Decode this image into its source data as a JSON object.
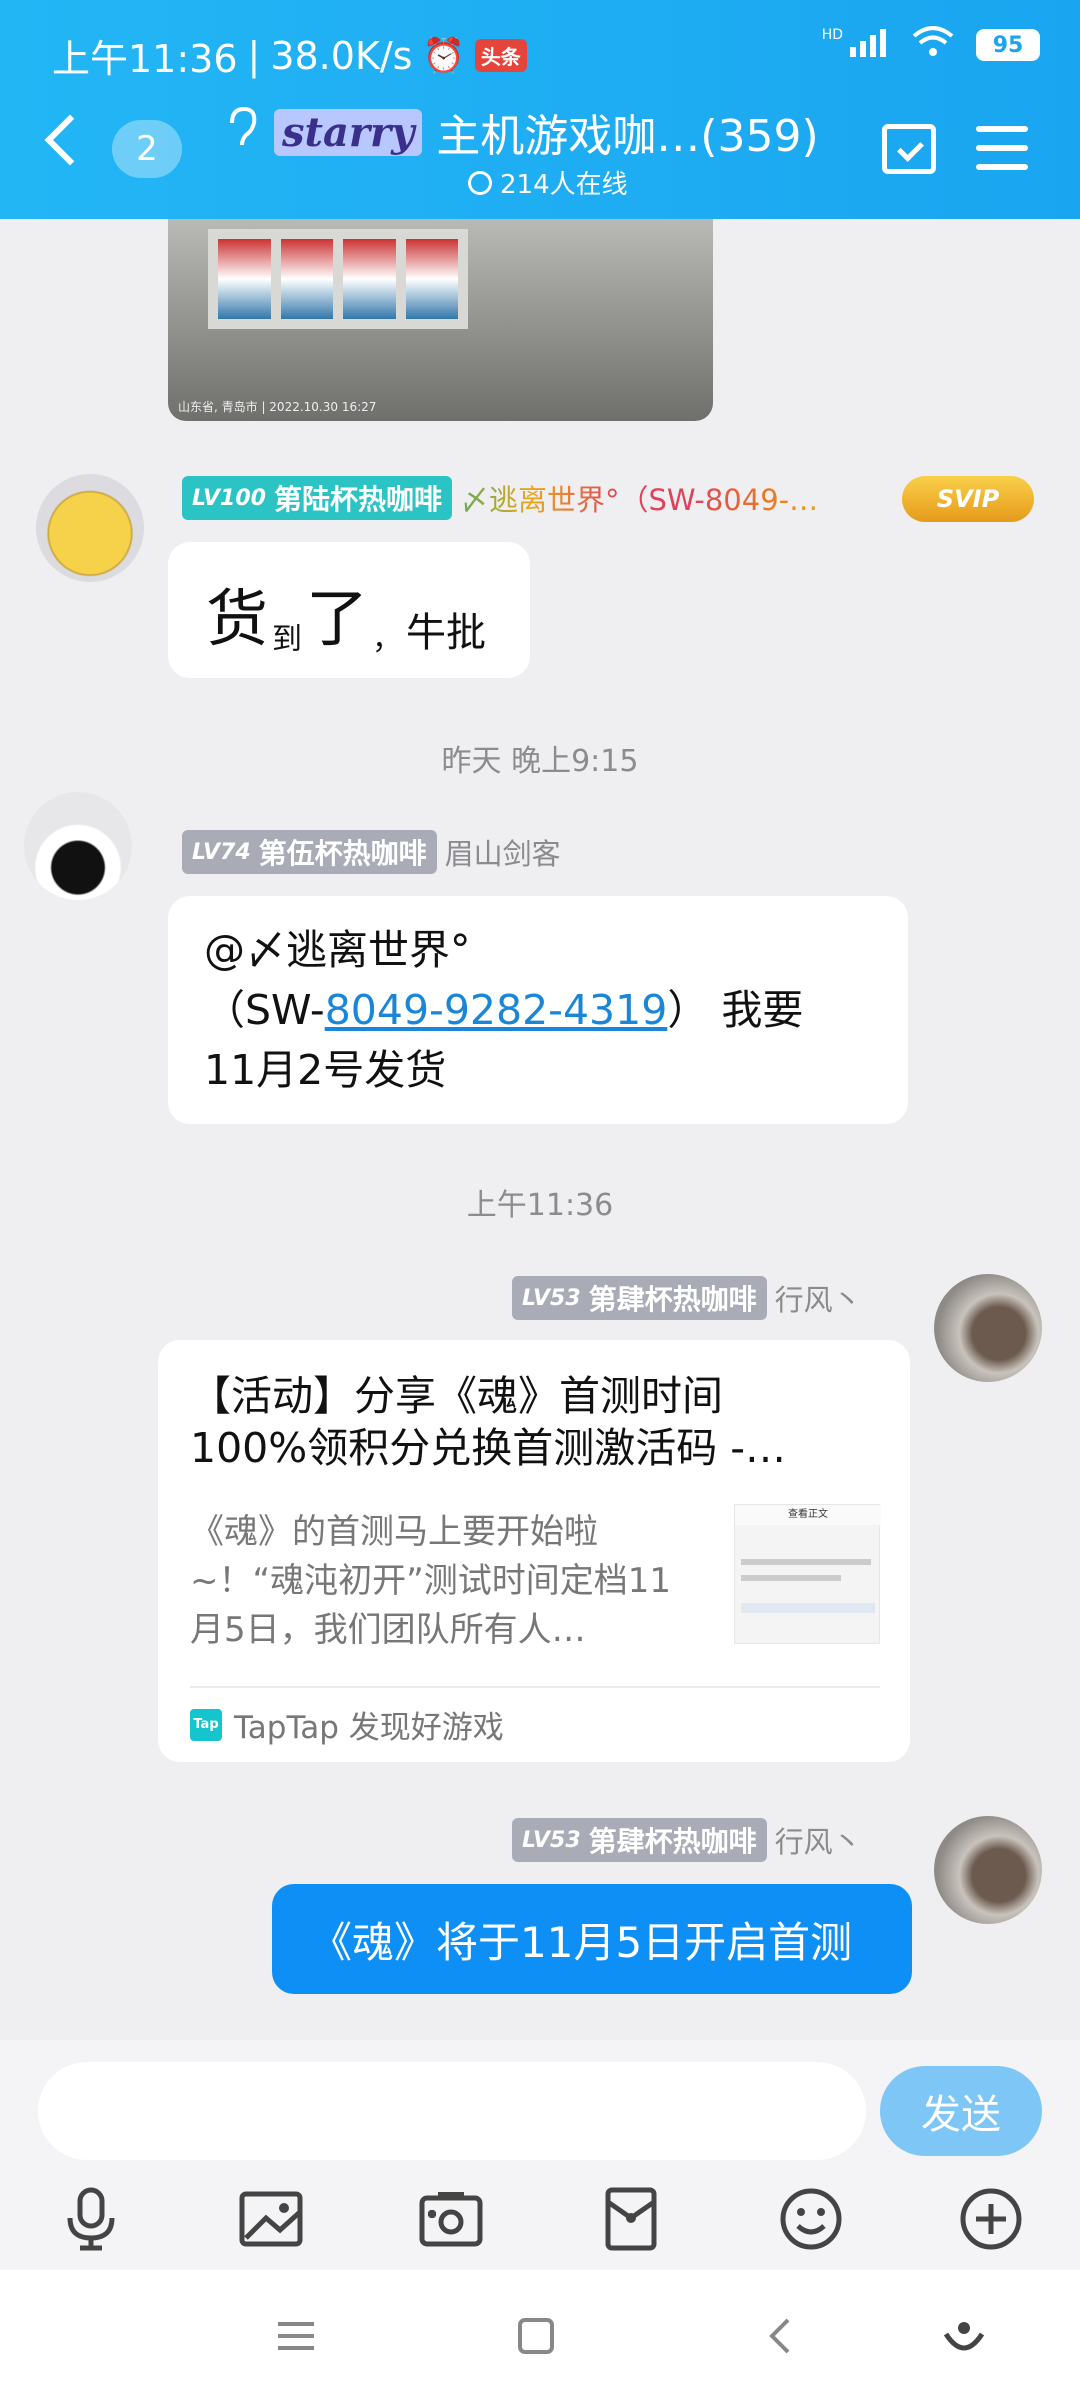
{
  "status_bar": {
    "time": "上午11:36",
    "speed": "38.0K/s",
    "news_badge": "头条",
    "signal_label": "HD",
    "battery": "95"
  },
  "header": {
    "unread_count": "2",
    "logo_text": "starry",
    "title": "主机游戏咖…(359)",
    "online": "214人在线"
  },
  "photo_caption": "山东省, 青岛市 | 2022.10.30 16:27",
  "messages": [
    {
      "level": "LV100",
      "rank": "第陆杯热咖啡",
      "nick": "〆逃离世界°（SW-8049-…",
      "badge": "SVIP",
      "parts": [
        "货",
        "到",
        "了",
        "，",
        "牛批"
      ]
    },
    {
      "timestamp": "昨天 晚上9:15"
    },
    {
      "level": "LV74",
      "rank": "第伍杯热咖啡",
      "nick": "眉山剑客",
      "line1": "@〆逃离世界°",
      "line2_pre": "（SW-",
      "line2_link": "8049-9282-4319",
      "line2_post": "） 我要",
      "line3": "11月2号发货"
    },
    {
      "timestamp": "上午11:36"
    },
    {
      "level": "LV53",
      "rank": "第肆杯热咖啡",
      "nick": "行风丶",
      "card_title": "【活动】分享《魂》首测时间100%领积分兑换首测激活码 -…",
      "card_desc": "《魂》的首测马上要开始啦~！“魂沌初开”测试时间定档11月5日，我们团队所有人…",
      "thumb_title": "查看正文",
      "card_source": "TapTap 发现好游戏",
      "tap_icon_text": "Tap"
    },
    {
      "level": "LV53",
      "rank": "第肆杯热咖啡",
      "nick": "行风丶",
      "text": "《魂》将于11月5日开启首测"
    }
  ],
  "input": {
    "placeholder": "",
    "send_label": "发送"
  },
  "toolbar_icons": [
    "microphone-icon",
    "image-icon",
    "camera-icon",
    "red-packet-icon",
    "emoji-icon",
    "plus-icon"
  ],
  "colors": {
    "header_bg": "#1aa5f0",
    "bubble_blue": "#0e8ff5",
    "send_button": "#7ec6f6"
  }
}
